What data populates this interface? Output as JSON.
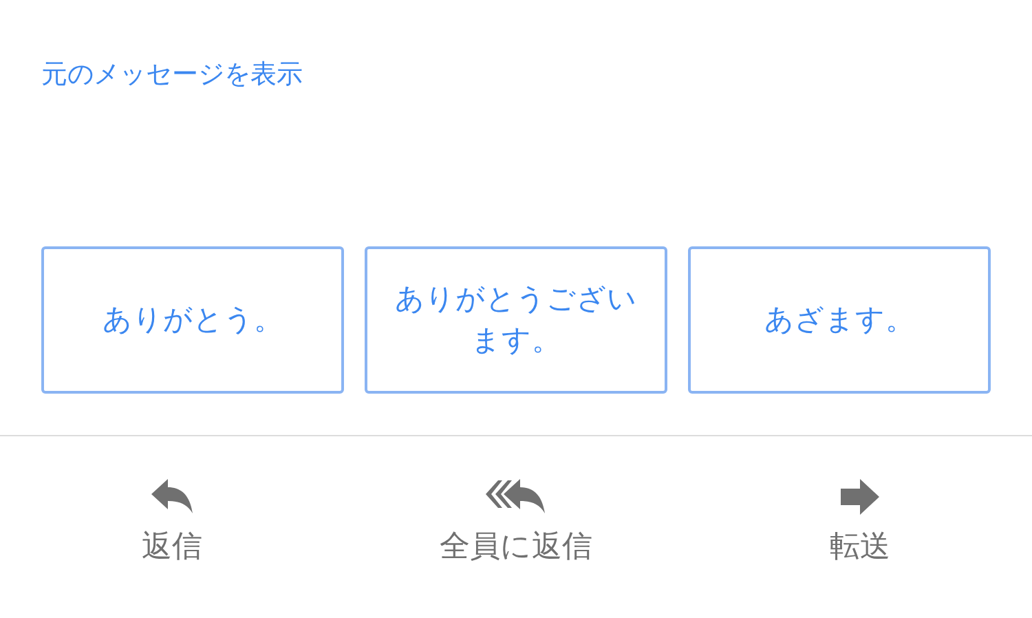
{
  "show_original_link": "元のメッセージを表示",
  "quick_replies": [
    "ありがとう。",
    "ありがとうございます。",
    "あざます。"
  ],
  "actions": [
    {
      "kind": "reply",
      "label": "返信"
    },
    {
      "kind": "reply_all",
      "label": "全員に返信"
    },
    {
      "kind": "forward",
      "label": "転送"
    }
  ]
}
